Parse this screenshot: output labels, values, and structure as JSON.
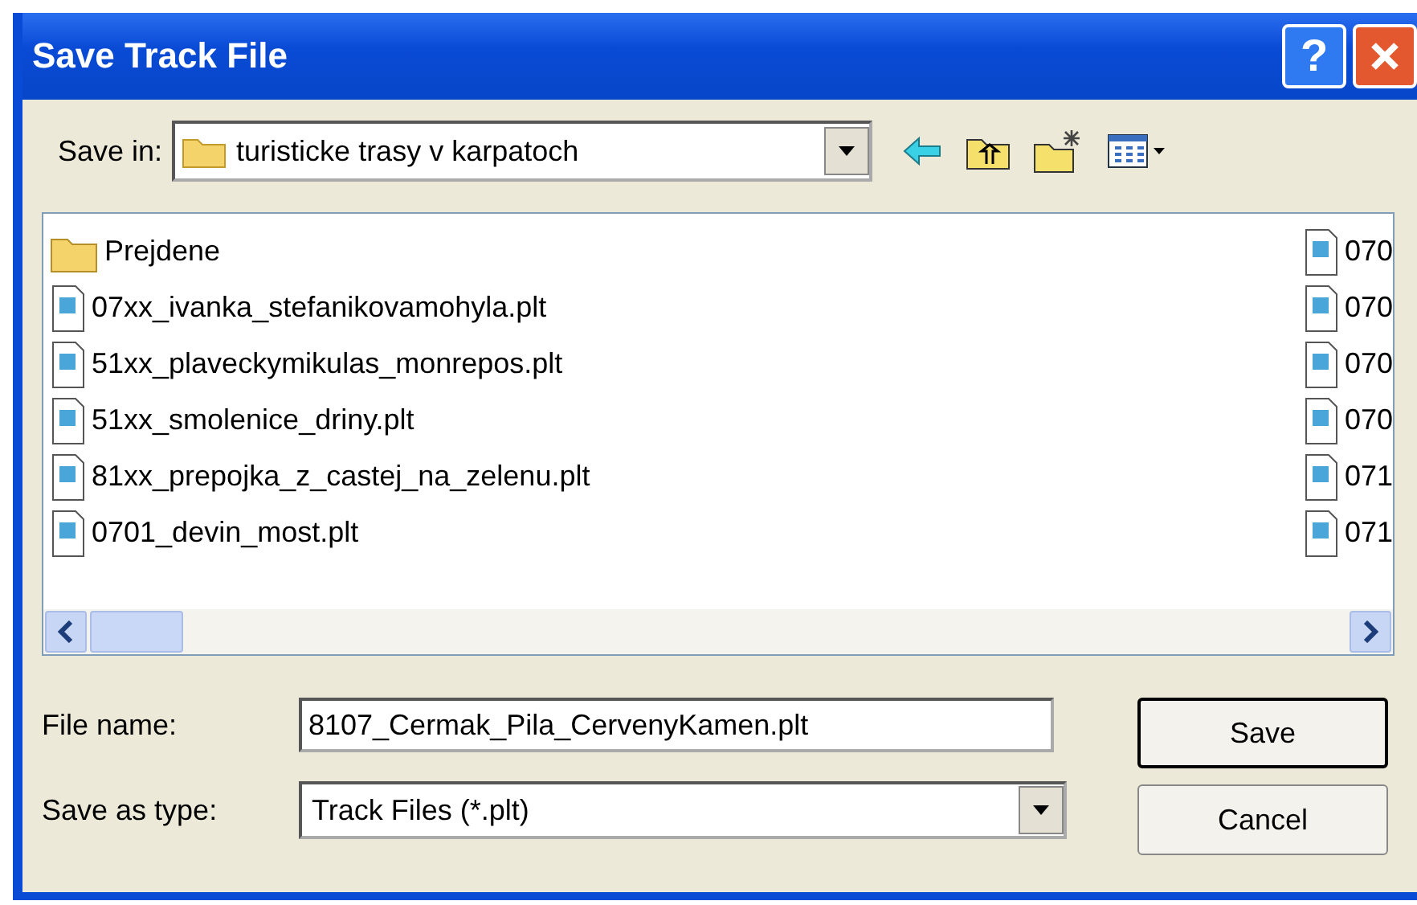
{
  "window": {
    "title": "Save Track File",
    "help_label": "?"
  },
  "save_in": {
    "label": "Save in:",
    "value": "turisticke trasy v karpatoch"
  },
  "files": [
    {
      "name": "Prejdene",
      "kind": "folder"
    },
    {
      "name": "07xx_ivanka_stefanikovamohyla.plt",
      "kind": "file"
    },
    {
      "name": "51xx_plaveckymikulas_monrepos.plt",
      "kind": "file"
    },
    {
      "name": "51xx_smolenice_driny.plt",
      "kind": "file"
    },
    {
      "name": "81xx_prepojka_z_castej_na_zelenu.plt",
      "kind": "file"
    },
    {
      "name": "0701_devin_most.plt",
      "kind": "file"
    }
  ],
  "files_column_2": [
    {
      "name": "070",
      "kind": "file"
    },
    {
      "name": "070",
      "kind": "file"
    },
    {
      "name": "070",
      "kind": "file"
    },
    {
      "name": "070",
      "kind": "file"
    },
    {
      "name": "071",
      "kind": "file"
    },
    {
      "name": "071",
      "kind": "file"
    }
  ],
  "file_name": {
    "label": "File name:",
    "value": "8107_Cermak_Pila_CervenyKamen.plt"
  },
  "save_as_type": {
    "label": "Save as type:",
    "value": "Track Files (*.plt)"
  },
  "buttons": [
    {
      "label": "Save",
      "default": true
    },
    {
      "label": "Cancel",
      "default": false
    }
  ]
}
